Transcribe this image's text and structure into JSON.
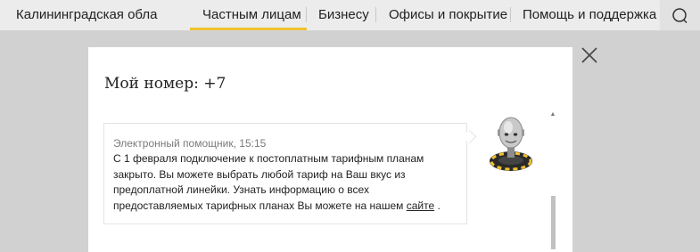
{
  "header": {
    "region": "Калининградская обла",
    "nav": [
      {
        "label": "Частным лицам",
        "active": true
      },
      {
        "label": "Бизнесу",
        "active": false
      },
      {
        "label": "Офисы и покрытие",
        "active": false
      },
      {
        "label": "Помощь и поддержка",
        "active": false
      }
    ],
    "search_icon": "search-icon"
  },
  "modal": {
    "title": "Мой номер: +7",
    "close_icon": "close-icon",
    "message": {
      "meta": "Электронный помощник, 15:15",
      "text": "С 1 февраля подключение к постоплатным тарифным планам закрыто. Вы можете выбрать любой тариф на Ваш вкус из предоплатной линейки. Узнать информацию о всех предоставляемых тарифных планах Вы можете на нашем ",
      "link": "сайте",
      "text_end": " ."
    },
    "avatar_icon": "robot-assistant-icon"
  },
  "colors": {
    "accent": "#f0c12f",
    "overlay": "#d1d1d1",
    "nav_bg": "#ececec"
  }
}
